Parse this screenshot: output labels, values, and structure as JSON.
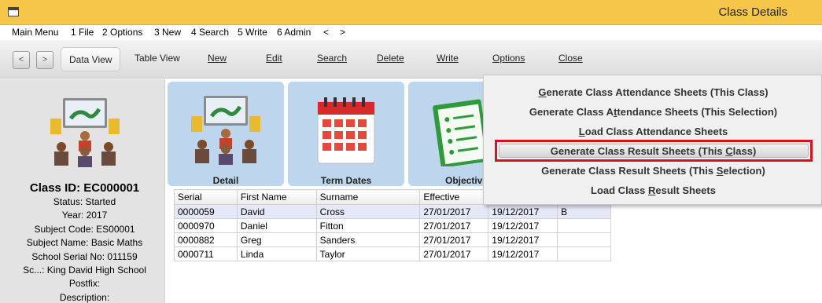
{
  "window": {
    "title": "Class Details"
  },
  "menubar": [
    "Main Menu",
    "1 File",
    "2 Options",
    "3 New",
    "4 Search",
    "5 Write",
    "6 Admin",
    "<",
    ">"
  ],
  "toolbar": {
    "back": "<",
    "forward": ">",
    "buttons": [
      "Data View",
      "Table View",
      "New",
      "Edit",
      "Search",
      "Delete",
      "Write",
      "Options",
      "Close"
    ]
  },
  "sidebar": {
    "class_id": "Class ID: EC000001",
    "fields": [
      "Status: Started",
      "Year: 2017",
      "Subject Code: ES00001",
      "Subject Name: Basic Maths",
      "School Serial No: 011159",
      "Sc...: King David High School",
      "Postfix:",
      "Description:"
    ]
  },
  "tiles": [
    {
      "label": "Detail",
      "icon": "classroom-icon"
    },
    {
      "label": "Term Dates",
      "icon": "calendar-icon"
    },
    {
      "label": "Objective",
      "icon": "checklist-icon"
    }
  ],
  "grid": {
    "columns": [
      "Serial",
      "First Name",
      "Surname",
      "Effective",
      "",
      ""
    ],
    "rows": [
      [
        "0000059",
        "David",
        "Cross",
        "27/01/2017",
        "19/12/2017",
        "B"
      ],
      [
        "0000970",
        "Daniel",
        "Fitton",
        "27/01/2017",
        "19/12/2017",
        ""
      ],
      [
        "0000882",
        "Greg",
        "Sanders",
        "27/01/2017",
        "19/12/2017",
        ""
      ],
      [
        "0000711",
        "Linda",
        "Taylor",
        "27/01/2017",
        "19/12/2017",
        ""
      ]
    ]
  },
  "options_menu": {
    "items": [
      {
        "pre": "",
        "u": "G",
        "post": "enerate Class Attendance Sheets (This Class)"
      },
      {
        "pre": "Generate Class A",
        "u": "t",
        "post": "tendance Sheets (This Selection)"
      },
      {
        "pre": "",
        "u": "L",
        "post": "oad Class Attendance Sheets"
      },
      {
        "pre": "Generate Class Result Sheets (This ",
        "u": "C",
        "post": "lass)"
      },
      {
        "pre": "Generate Class Result Sheets (This ",
        "u": "S",
        "post": "election)"
      },
      {
        "pre": "Load Class ",
        "u": "R",
        "post": "esult Sheets"
      }
    ],
    "highlight_color": "#d9121b"
  }
}
